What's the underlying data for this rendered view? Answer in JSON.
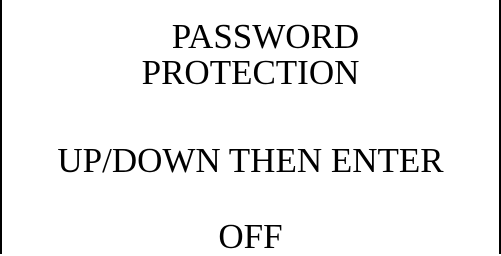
{
  "display": {
    "title_line_1": "PASSWORD",
    "title_line_2": "PROTECTION",
    "instruction": "UP/DOWN THEN ENTER",
    "current_value": "OFF"
  }
}
